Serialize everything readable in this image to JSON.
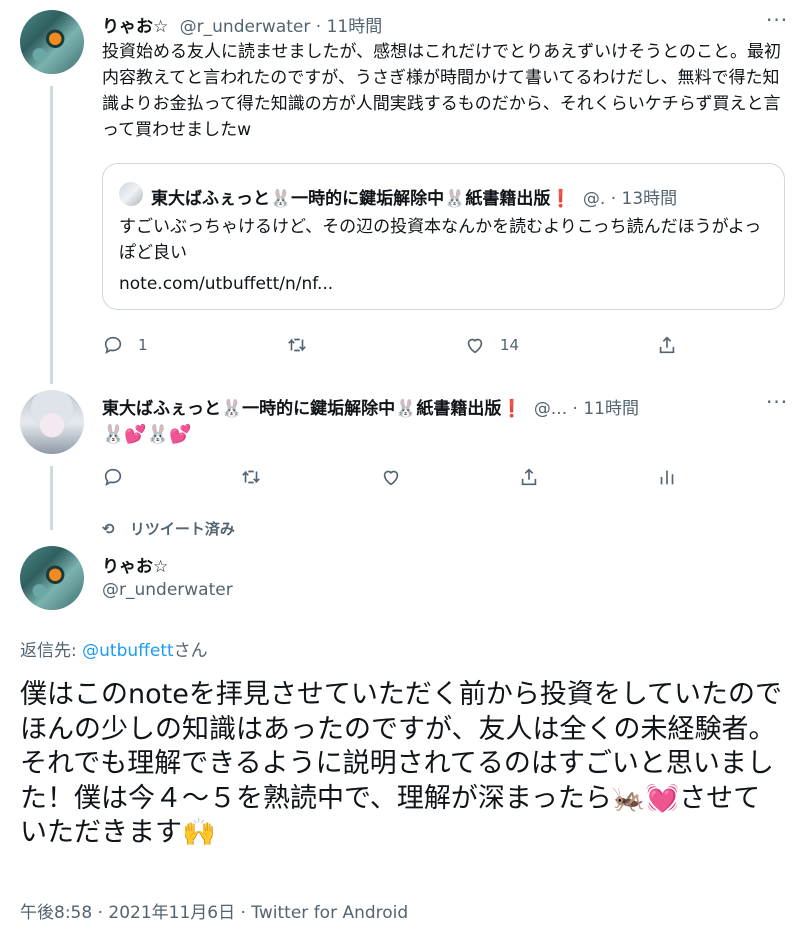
{
  "tweet1": {
    "name": "りゃお☆",
    "handle": "@r_underwater · 11時間",
    "text": "投資始める友人に読ませましたが、感想はこれだけでとりあえずいけそうとのこと。最初内容教えてと言われたのですが、うさぎ様が時間かけて書いてるわけだし、無料で得た知識よりお金払って得た知識の方が人間実践するものだから、それくらいケチらず買えと言って買わせましたw",
    "quote": {
      "name": "東大ばふぇっと🐰一時的に鍵垢解除中🐰紙書籍出版❗",
      "meta": "@. · 13時間",
      "text": "すごいぶっちゃけるけど、その辺の投資本なんかを読むよりこっち読んだほうがよっぽど良い",
      "link": "note.com/utbuffett/n/nf..."
    },
    "actions": {
      "reply": "1",
      "retweet": "",
      "like": "14"
    }
  },
  "tweet2": {
    "name": "東大ばふぇっと🐰一時的に鍵垢解除中🐰紙書籍出版❗",
    "meta": "@... · 11時間",
    "text": "🐰💕🐰💕"
  },
  "main": {
    "retweeted": "リツイート済み",
    "name": "りゃお☆",
    "handle": "@r_underwater",
    "reply_prefix": "返信先: ",
    "reply_to": "@utbuffett",
    "reply_suffix": "さん",
    "text": "僕はこのnoteを拝見させていただく前から投資をしていたのでほんの少しの知識はあったのですが、友人は全くの未経験者。それでも理解できるように説明されてるのはすごいと思いました！僕は今４～５を熟読中で、理解が深まったら🦗💓させていただきます🙌",
    "footer": "午後8:58 · 2021年11月6日 · Twitter for Android"
  },
  "icons": {
    "more": "more-icon",
    "reply": "reply-icon",
    "retweet": "retweet-icon",
    "like": "like-icon",
    "share": "share-icon",
    "analytics": "analytics-icon"
  },
  "colors": {
    "link": "#1d9bf0",
    "muted": "#536471",
    "text": "#0f1419"
  }
}
